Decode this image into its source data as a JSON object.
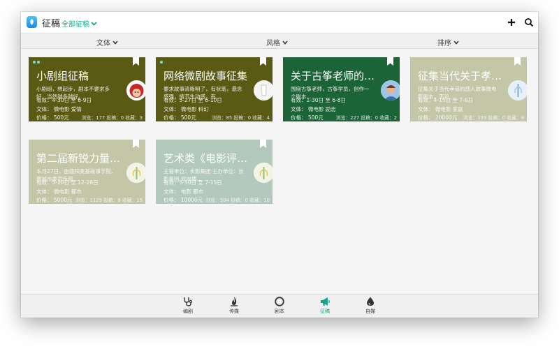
{
  "app": {
    "title": "征稿",
    "filter": "全部征稿"
  },
  "toolbar": {
    "sort_type": "文体",
    "sort_style": "风格",
    "sort_order": "排序"
  },
  "cards": [
    {
      "title": "小剧组征稿",
      "desc1": "小剧组，想起步，剧本不要求多",
      "desc2": "好，当然越多越好。",
      "date": "有效：4-30日 至 6-9日",
      "genre": "文体：  微电影  爱情",
      "price": "价格：   500元",
      "stats": "浏览：177 投稿：0 收藏：3",
      "color": "#5a5a14"
    },
    {
      "title": "网络微剧故事征集",
      "desc1": "要求故事清晰明了，有状笔，悬念",
      "desc2": "感强，情节生动感，有…",
      "date": "有效：5-27日 至 6-10日",
      "genre": "文体：  微电影  科幻",
      "price": "价格：   500元",
      "stats": "浏览：85 投稿：0 收藏：4",
      "color": "#5a5a14"
    },
    {
      "title": "关于古筝老师的…",
      "desc1": "围绕古筝老师，古筝学员，创作一",
      "desc2": "个剧本…",
      "date": "有效：1-30日 至 6-8日",
      "genre": "文体：  微电影  励志",
      "price": "价格：   500元",
      "stats": "浏览：227 投稿：0 收藏：2",
      "color": "#1b6437"
    },
    {
      "title": "征集当代关于孝…",
      "desc1": "征集关于当代孝道的感人故事微电",
      "desc2": "影剧本，无论…",
      "date": "有效：4-15日 至 7-6日",
      "genre": "文体：  微电影  家庭",
      "price": "价格：   20000元",
      "stats": "浏览：333 投稿：0 收藏：8",
      "color": "#c4c6a8"
    },
    {
      "title": "第二届新锐力量…",
      "desc1": "本月27日，由德阳麦基故事学院、",
      "desc2": "晋城市委宣传部…",
      "date": "有效：5-20日 至 12-28日",
      "genre": "文体：  微电影  都市",
      "price": "价格：   5000元",
      "stats": "浏览：1129 投稿：8 收藏：19",
      "color": "#c4c6a8"
    },
    {
      "title": "艺术类《电影评…",
      "desc1": "主管单位：长影集团  主办单位：长",
      "desc2": "影集团 双向播…",
      "date": "有效：5-30日 至 7-15日",
      "genre": "文体：  电影  都市",
      "price": "价格：   10000元",
      "stats": "浏览：504 投稿：0 收藏：10",
      "color": "#b4c9bd"
    }
  ],
  "nav": [
    {
      "label": "编剧",
      "icon": "stethoscope-icon"
    },
    {
      "label": "传媒",
      "icon": "flame-icon"
    },
    {
      "label": "剧本",
      "icon": "circle-icon"
    },
    {
      "label": "征稿",
      "icon": "megaphone-icon"
    },
    {
      "label": "自媒",
      "icon": "drop-icon"
    }
  ],
  "colors": {
    "accent": "#17a589"
  }
}
